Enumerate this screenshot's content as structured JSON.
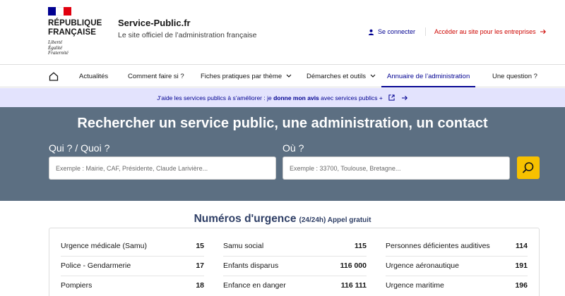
{
  "brand": {
    "name_line1": "RÉPUBLIQUE",
    "name_line2": "FRANÇAISE",
    "motto": [
      "Liberté",
      "Égalité",
      "Fraternité"
    ],
    "flag_colors": [
      "#000091",
      "#ffffff",
      "#e1000f"
    ]
  },
  "site": {
    "title": "Service-Public.fr",
    "tagline": "Le site officiel de l’administration française"
  },
  "tools": {
    "login_label": "Se connecter",
    "pro_label": "Accéder au site pour les entreprises",
    "login_icon": "user-icon",
    "pro_icon": "arrow-right-icon"
  },
  "nav": {
    "home_icon": "home-icon",
    "items": [
      {
        "label": "Actualités",
        "dropdown": false
      },
      {
        "label": "Comment faire si ?",
        "dropdown": false
      },
      {
        "label": "Fiches pratiques par thème",
        "dropdown": true
      },
      {
        "label": "Démarches et outils",
        "dropdown": true
      },
      {
        "label": "Annuaire de l’administration",
        "dropdown": false,
        "active": true
      },
      {
        "label": "Une question ?",
        "dropdown": false
      }
    ]
  },
  "banner": {
    "text_before": "J’aide les services publics à s’améliorer : je ",
    "link_bold": "donne mon avis",
    "text_after": " avec services publics +"
  },
  "search": {
    "title": "Rechercher un service public, une administration, un contact",
    "who_label": "Qui ? / Quoi ?",
    "who_placeholder": "Exemple : Mairie, CAF, Présidente, Claude Larivière...",
    "where_label": "Où ?",
    "where_placeholder": "Exemple : 33700, Toulouse, Bretagne...",
    "button_icon": "search-icon",
    "button_color": "#f7c100",
    "background_color": "#5c6f82"
  },
  "emergency": {
    "title": "Numéros d'urgence",
    "subtitle": "(24/24h) Appel gratuit",
    "columns": [
      [
        {
          "label": "Urgence médicale (Samu)",
          "number": "15"
        },
        {
          "label": "Police - Gendarmerie",
          "number": "17"
        },
        {
          "label": "Pompiers",
          "number": "18"
        }
      ],
      [
        {
          "label": "Samu social",
          "number": "115"
        },
        {
          "label": "Enfants disparus",
          "number": "116 000"
        },
        {
          "label": "Enfance en danger",
          "number": "116 111"
        }
      ],
      [
        {
          "label": "Personnes déficientes auditives",
          "number": "114"
        },
        {
          "label": "Urgence aéronautique",
          "number": "191"
        },
        {
          "label": "Urgence maritime",
          "number": "196"
        }
      ]
    ]
  }
}
